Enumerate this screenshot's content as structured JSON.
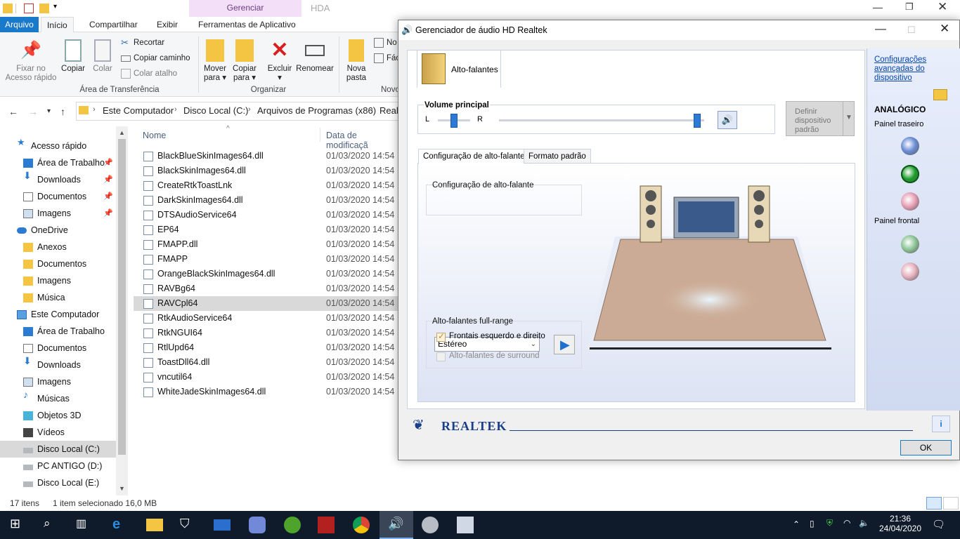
{
  "explorer": {
    "ribbon_tabs": {
      "file": "Arquivo",
      "home": "Início",
      "share": "Compartilhar",
      "view": "Exibir",
      "tools": "Ferramentas de Aplicativo"
    },
    "context_header": "Gerenciar",
    "context_title": "HDA",
    "ribbon": {
      "pin": "Fixar no Acesso rápido",
      "copy": "Copiar",
      "paste": "Colar",
      "cut": "Recortar",
      "copy_path": "Copiar caminho",
      "paste_shortcut": "Colar atalho",
      "group_clipboard": "Área de Transferência",
      "move_to": "Mover para",
      "copy_to": "Copiar para",
      "delete": "Excluir",
      "rename": "Renomear",
      "group_organize": "Organizar",
      "new_folder": "Nova pasta",
      "new_item": "No",
      "easy_access": "Fác",
      "group_new": "Novo"
    },
    "breadcrumb": [
      "Este Computador",
      "Disco Local (C:)",
      "Arquivos de Programas (x86)",
      "Realt"
    ],
    "nav": [
      {
        "label": "Acesso rápido",
        "icon": "star-icon",
        "level": 0
      },
      {
        "label": "Área de Trabalho",
        "icon": "desktop-icon",
        "level": 1,
        "pinned": true
      },
      {
        "label": "Downloads",
        "icon": "download-icon",
        "level": 1,
        "pinned": true
      },
      {
        "label": "Documentos",
        "icon": "document-icon",
        "level": 1,
        "pinned": true
      },
      {
        "label": "Imagens",
        "icon": "image-icon",
        "level": 1,
        "pinned": true
      },
      {
        "label": "OneDrive",
        "icon": "cloud-icon",
        "level": 0
      },
      {
        "label": "Anexos",
        "icon": "folder-icon",
        "level": 1
      },
      {
        "label": "Documentos",
        "icon": "folder-icon",
        "level": 1
      },
      {
        "label": "Imagens",
        "icon": "folder-icon",
        "level": 1
      },
      {
        "label": "Música",
        "icon": "folder-icon",
        "level": 1
      },
      {
        "label": "Este Computador",
        "icon": "computer-icon",
        "level": 0
      },
      {
        "label": "Área de Trabalho",
        "icon": "desktop-icon",
        "level": 1
      },
      {
        "label": "Documentos",
        "icon": "document-icon",
        "level": 1
      },
      {
        "label": "Downloads",
        "icon": "download-icon",
        "level": 1
      },
      {
        "label": "Imagens",
        "icon": "image-icon",
        "level": 1
      },
      {
        "label": "Músicas",
        "icon": "music-icon",
        "level": 1
      },
      {
        "label": "Objetos 3D",
        "icon": "cube-icon",
        "level": 1
      },
      {
        "label": "Vídeos",
        "icon": "video-icon",
        "level": 1
      },
      {
        "label": "Disco Local (C:)",
        "icon": "drive-icon",
        "level": 1,
        "selected": true
      },
      {
        "label": "PC ANTIGO (D:)",
        "icon": "drive-icon",
        "level": 1
      },
      {
        "label": "Disco Local (E:)",
        "icon": "drive-icon",
        "level": 1
      }
    ],
    "columns": {
      "name": "Nome",
      "date": "Data de modificaçã"
    },
    "files": [
      {
        "name": "BlackBlueSkinImages64.dll",
        "date": "01/03/2020 14:54"
      },
      {
        "name": "BlackSkinImages64.dll",
        "date": "01/03/2020 14:54"
      },
      {
        "name": "CreateRtkToastLnk",
        "date": "01/03/2020 14:54"
      },
      {
        "name": "DarkSkinImages64.dll",
        "date": "01/03/2020 14:54"
      },
      {
        "name": "DTSAudioService64",
        "date": "01/03/2020 14:54"
      },
      {
        "name": "EP64",
        "date": "01/03/2020 14:54"
      },
      {
        "name": "FMAPP.dll",
        "date": "01/03/2020 14:54"
      },
      {
        "name": "FMAPP",
        "date": "01/03/2020 14:54"
      },
      {
        "name": "OrangeBlackSkinImages64.dll",
        "date": "01/03/2020 14:54"
      },
      {
        "name": "RAVBg64",
        "date": "01/03/2020 14:54"
      },
      {
        "name": "RAVCpl64",
        "date": "01/03/2020 14:54",
        "selected": true
      },
      {
        "name": "RtkAudioService64",
        "date": "01/03/2020 14:54"
      },
      {
        "name": "RtkNGUI64",
        "date": "01/03/2020 14:54"
      },
      {
        "name": "RtlUpd64",
        "date": "01/03/2020 14:54"
      },
      {
        "name": "ToastDll64.dll",
        "date": "01/03/2020 14:54"
      },
      {
        "name": "vncutil64",
        "date": "01/03/2020 14:54"
      },
      {
        "name": "WhiteJadeSkinImages64.dll",
        "date": "01/03/2020 14:54"
      }
    ],
    "status": {
      "count": "17 itens",
      "selection": "1 item selecionado  16,0 MB"
    }
  },
  "realtek": {
    "title": "Gerenciador de áudio HD Realtek",
    "tab": "Alto-falantes",
    "volume_label": "Volume principal",
    "balance_left": "L",
    "balance_right": "R",
    "balance_level": 0.5,
    "volume_level": 1.0,
    "default_device": "Definir dispositivo padrão",
    "inner_tabs": [
      "Configuração de alto-falante",
      "Formato padrão"
    ],
    "speaker_config_label": "Configuração de alto-falante",
    "speaker_config_value": "Estéreo",
    "fullrange_label": "Alto-falantes full-range",
    "front_lr": "Frontais esquerdo e direito",
    "front_lr_checked": true,
    "surround": "Alto-falantes de surround",
    "surround_checked": false,
    "advanced_link": "Configurações avançadas do dispositivo",
    "analog": "ANALÓGICO",
    "rear_panel": "Painel traseiro",
    "front_panel": "Painel frontal",
    "brand": "REALTEK",
    "ok": "OK",
    "jack_colors": {
      "blue": "#6d8fd6",
      "green": "#1a9e2a",
      "pink": "#e8a2b8",
      "green_off": "#8fc79a",
      "pink_off": "#e6b3bf"
    }
  },
  "taskbar": {
    "time": "21:36",
    "date": "24/04/2020"
  }
}
